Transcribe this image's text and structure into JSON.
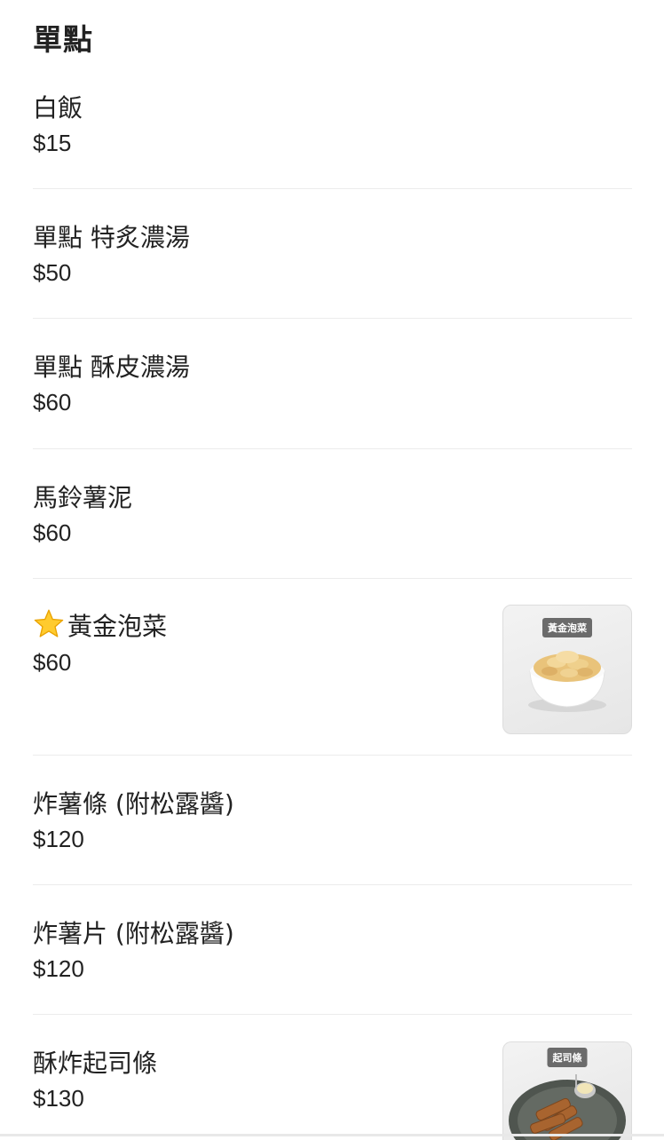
{
  "section": {
    "title": "單點"
  },
  "items": [
    {
      "name": "白飯",
      "price": "$15"
    },
    {
      "name": "單點 特炙濃湯",
      "price": "$50"
    },
    {
      "name": "單點 酥皮濃湯",
      "price": "$60"
    },
    {
      "name": "馬鈴薯泥",
      "price": "$60"
    },
    {
      "name": "黃金泡菜",
      "price": "$60",
      "icon": "star-icon",
      "image_label": "黃金泡菜"
    },
    {
      "name": "炸薯條 (附松露醬)",
      "price": "$120"
    },
    {
      "name": "炸薯片 (附松露醬)",
      "price": "$120"
    },
    {
      "name": "酥炸起司條",
      "price": "$130",
      "image_label": "起司條"
    }
  ]
}
